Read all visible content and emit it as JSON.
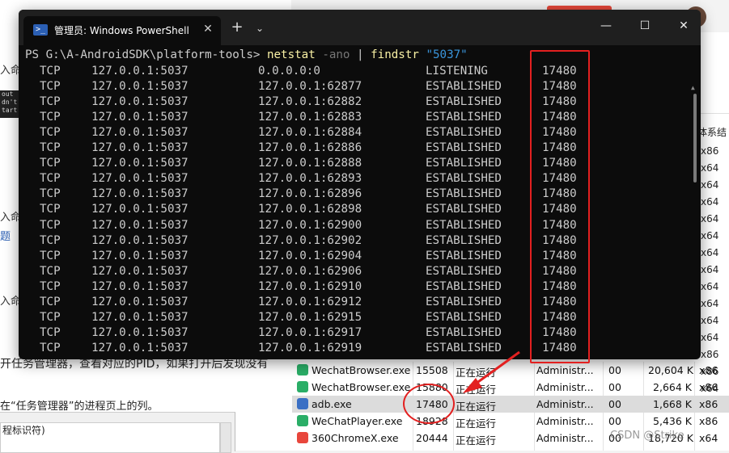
{
  "terminal": {
    "title": "管理员: Windows PowerShell",
    "new_tab": "+",
    "dropdown": "⌄",
    "close_tab": "✕",
    "min": "—",
    "max": "☐",
    "close": "✕",
    "prompt": "PS G:\\A-AndroidSDK\\platform-tools> ",
    "cmd": "netstat",
    "flag": "-ano",
    "pipe": " | ",
    "cmd2": "findstr",
    "arg": "\"5037\"",
    "rows": [
      {
        "proto": "TCP",
        "local": "127.0.0.1:5037",
        "foreign": "0.0.0.0:0",
        "state": "LISTENING",
        "pid": "17480"
      },
      {
        "proto": "TCP",
        "local": "127.0.0.1:5037",
        "foreign": "127.0.0.1:62877",
        "state": "ESTABLISHED",
        "pid": "17480"
      },
      {
        "proto": "TCP",
        "local": "127.0.0.1:5037",
        "foreign": "127.0.0.1:62882",
        "state": "ESTABLISHED",
        "pid": "17480"
      },
      {
        "proto": "TCP",
        "local": "127.0.0.1:5037",
        "foreign": "127.0.0.1:62883",
        "state": "ESTABLISHED",
        "pid": "17480"
      },
      {
        "proto": "TCP",
        "local": "127.0.0.1:5037",
        "foreign": "127.0.0.1:62884",
        "state": "ESTABLISHED",
        "pid": "17480"
      },
      {
        "proto": "TCP",
        "local": "127.0.0.1:5037",
        "foreign": "127.0.0.1:62886",
        "state": "ESTABLISHED",
        "pid": "17480"
      },
      {
        "proto": "TCP",
        "local": "127.0.0.1:5037",
        "foreign": "127.0.0.1:62888",
        "state": "ESTABLISHED",
        "pid": "17480"
      },
      {
        "proto": "TCP",
        "local": "127.0.0.1:5037",
        "foreign": "127.0.0.1:62893",
        "state": "ESTABLISHED",
        "pid": "17480"
      },
      {
        "proto": "TCP",
        "local": "127.0.0.1:5037",
        "foreign": "127.0.0.1:62896",
        "state": "ESTABLISHED",
        "pid": "17480"
      },
      {
        "proto": "TCP",
        "local": "127.0.0.1:5037",
        "foreign": "127.0.0.1:62898",
        "state": "ESTABLISHED",
        "pid": "17480"
      },
      {
        "proto": "TCP",
        "local": "127.0.0.1:5037",
        "foreign": "127.0.0.1:62900",
        "state": "ESTABLISHED",
        "pid": "17480"
      },
      {
        "proto": "TCP",
        "local": "127.0.0.1:5037",
        "foreign": "127.0.0.1:62902",
        "state": "ESTABLISHED",
        "pid": "17480"
      },
      {
        "proto": "TCP",
        "local": "127.0.0.1:5037",
        "foreign": "127.0.0.1:62904",
        "state": "ESTABLISHED",
        "pid": "17480"
      },
      {
        "proto": "TCP",
        "local": "127.0.0.1:5037",
        "foreign": "127.0.0.1:62906",
        "state": "ESTABLISHED",
        "pid": "17480"
      },
      {
        "proto": "TCP",
        "local": "127.0.0.1:5037",
        "foreign": "127.0.0.1:62910",
        "state": "ESTABLISHED",
        "pid": "17480"
      },
      {
        "proto": "TCP",
        "local": "127.0.0.1:5037",
        "foreign": "127.0.0.1:62912",
        "state": "ESTABLISHED",
        "pid": "17480"
      },
      {
        "proto": "TCP",
        "local": "127.0.0.1:5037",
        "foreign": "127.0.0.1:62915",
        "state": "ESTABLISHED",
        "pid": "17480"
      },
      {
        "proto": "TCP",
        "local": "127.0.0.1:5037",
        "foreign": "127.0.0.1:62917",
        "state": "ESTABLISHED",
        "pid": "17480"
      },
      {
        "proto": "TCP",
        "local": "127.0.0.1:5037",
        "foreign": "127.0.0.1:62919",
        "state": "ESTABLISHED",
        "pid": "17480"
      }
    ]
  },
  "task_manager": {
    "column_head": "体系结",
    "side_archs": [
      "x86",
      "x64",
      "x64",
      "x64",
      "x64",
      "x64",
      "x64",
      "x64",
      "x64",
      "x64",
      "x64",
      "x64",
      "x86",
      "x86",
      "x64"
    ],
    "rows": [
      {
        "name": "WechatBrowser.exe",
        "pid": "15508",
        "status": "正在运行",
        "user": "Administr...",
        "cpu": "00",
        "mem": "20,604 K",
        "arch": "x86",
        "icon_color": "#2aae67"
      },
      {
        "name": "WechatBrowser.exe",
        "pid": "15880",
        "status": "正在运行",
        "user": "Administr...",
        "cpu": "00",
        "mem": "2,664 K",
        "arch": "x86",
        "icon_color": "#2aae67"
      },
      {
        "name": "adb.exe",
        "pid": "17480",
        "status": "正在运行",
        "user": "Administr...",
        "cpu": "00",
        "mem": "1,668 K",
        "arch": "x86",
        "icon_color": "#3a6fc4",
        "highlight": true
      },
      {
        "name": "WeChatPlayer.exe",
        "pid": "18928",
        "status": "正在运行",
        "user": "Administr...",
        "cpu": "00",
        "mem": "5,436 K",
        "arch": "x86",
        "icon_color": "#2aae67"
      },
      {
        "name": "360ChromeX.exe",
        "pid": "20444",
        "status": "正在运行",
        "user": "Administr...",
        "cpu": "00",
        "mem": "18,720 K",
        "arch": "x64",
        "icon_color": "#e8463c"
      }
    ]
  },
  "doc": {
    "frag1": "入命",
    "frag2": "入命",
    "frag3": "题",
    "frag4": "入命",
    "caption": "开任务管理器，查看对应的PID，如果打开后发现没有",
    "note": "在“任务管理器”的进程页上的列。",
    "mini_label": "程标识符)",
    "strip": "out\ndn't\ntart"
  },
  "watermark": "CSDN @Strike"
}
